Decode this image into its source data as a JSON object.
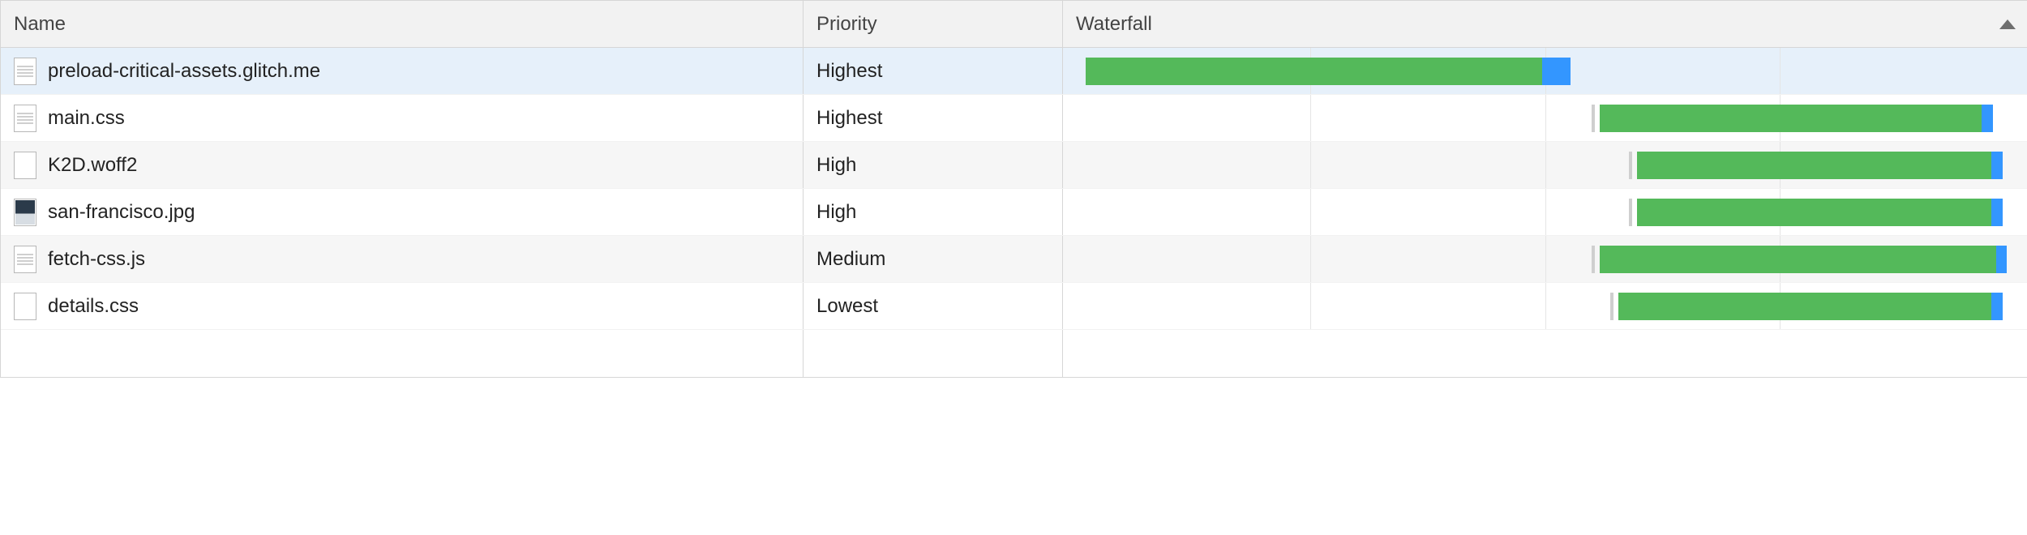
{
  "columns": {
    "name": "Name",
    "priority": "Priority",
    "waterfall": "Waterfall"
  },
  "sort": {
    "column": "waterfall",
    "direction": "asc"
  },
  "waterfall_gridlines_pct": [
    25,
    50,
    75
  ],
  "rows": [
    {
      "name": "preload-critical-assets.glitch.me",
      "priority": "Highest",
      "icon": "doc",
      "selected": true,
      "wf": {
        "start_pct": 1,
        "green_pct": 49,
        "blue_pct": 3,
        "wait_tick": false
      }
    },
    {
      "name": "main.css",
      "priority": "Highest",
      "icon": "doc",
      "selected": false,
      "wf": {
        "start_pct": 56,
        "green_pct": 41,
        "blue_pct": 1.2,
        "wait_tick": true
      }
    },
    {
      "name": "K2D.woff2",
      "priority": "High",
      "icon": "outline",
      "selected": false,
      "wf": {
        "start_pct": 60,
        "green_pct": 38,
        "blue_pct": 1.2,
        "wait_tick": true
      }
    },
    {
      "name": "san-francisco.jpg",
      "priority": "High",
      "icon": "image",
      "selected": false,
      "wf": {
        "start_pct": 60,
        "green_pct": 38,
        "blue_pct": 1.2,
        "wait_tick": true
      }
    },
    {
      "name": "fetch-css.js",
      "priority": "Medium",
      "icon": "doc",
      "selected": false,
      "wf": {
        "start_pct": 56,
        "green_pct": 42.5,
        "blue_pct": 1.2,
        "wait_tick": true
      }
    },
    {
      "name": "details.css",
      "priority": "Lowest",
      "icon": "outline",
      "selected": false,
      "wf": {
        "start_pct": 58,
        "green_pct": 40,
        "blue_pct": 1.2,
        "wait_tick": true
      }
    }
  ]
}
